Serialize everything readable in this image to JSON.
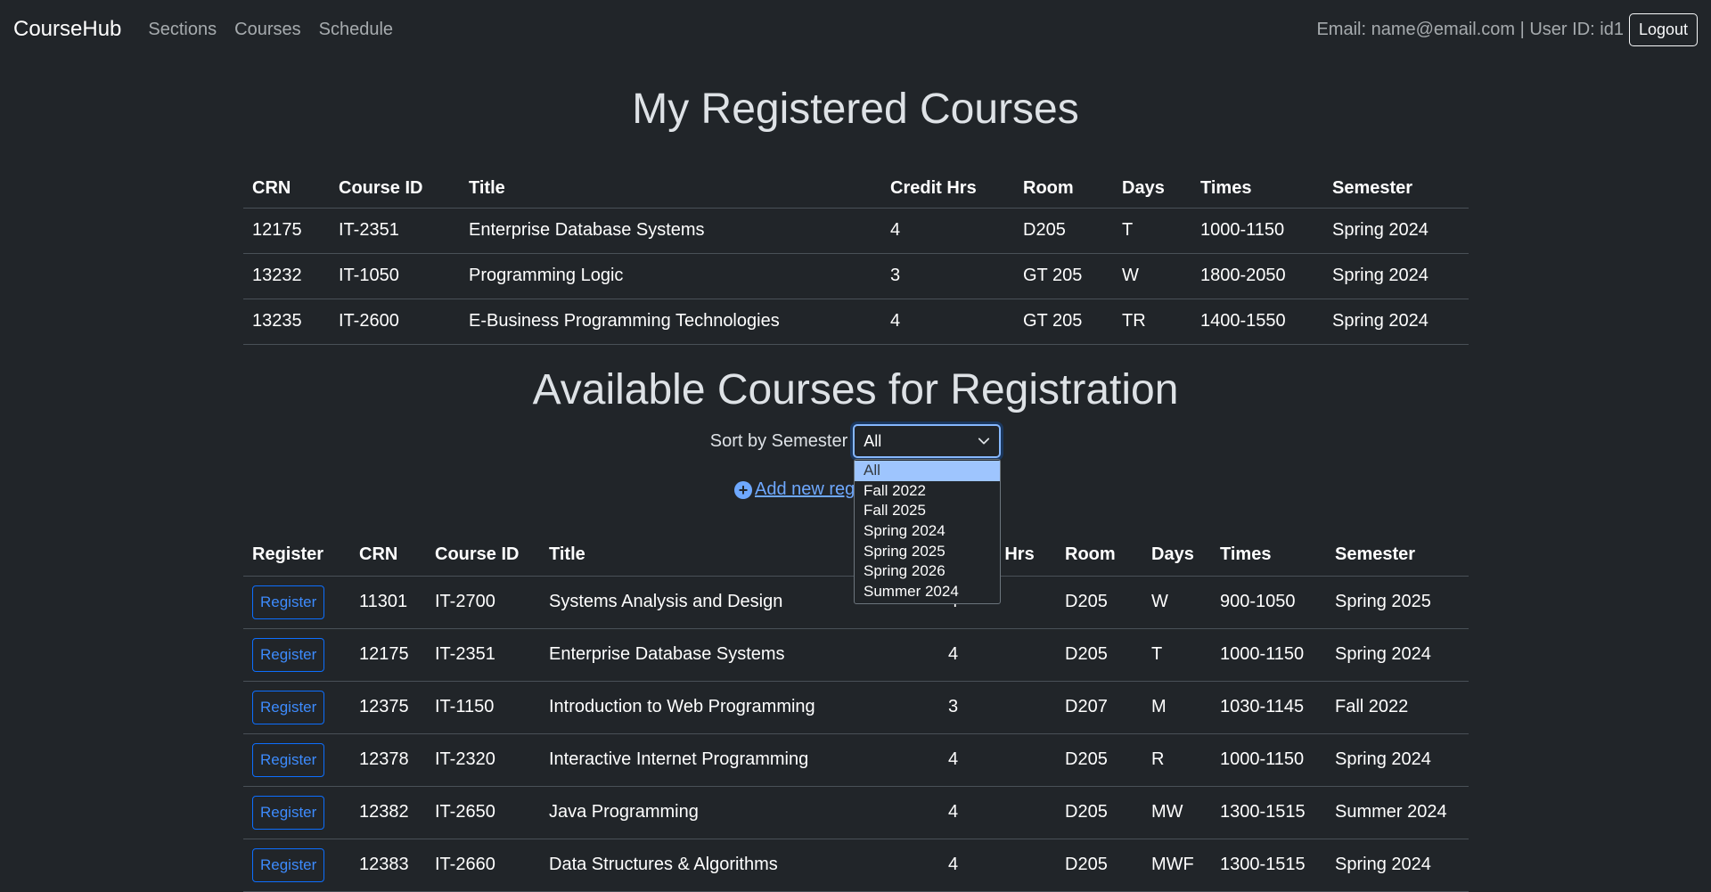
{
  "nav": {
    "brand": "CourseHub",
    "links": [
      "Sections",
      "Courses",
      "Schedule"
    ],
    "user_info": "Email: name@email.com | User ID: id1",
    "logout_label": "Logout"
  },
  "registered": {
    "title": "My Registered Courses",
    "headers": [
      "CRN",
      "Course ID",
      "Title",
      "Credit Hrs",
      "Room",
      "Days",
      "Times",
      "Semester"
    ],
    "rows": [
      [
        "12175",
        "IT-2351",
        "Enterprise Database Systems",
        "4",
        "D205",
        "T",
        "1000-1150",
        "Spring 2024"
      ],
      [
        "13232",
        "IT-1050",
        "Programming Logic",
        "3",
        "GT 205",
        "W",
        "1800-2050",
        "Spring 2024"
      ],
      [
        "13235",
        "IT-2600",
        "E-Business Programming Technologies",
        "4",
        "GT 205",
        "TR",
        "1400-1550",
        "Spring 2024"
      ]
    ]
  },
  "available": {
    "title": "Available Courses for Registration",
    "sort_label": "Sort by Semester",
    "sort_selected": "All",
    "sort_options": [
      "All",
      "Fall 2022",
      "Fall 2025",
      "Spring 2024",
      "Spring 2025",
      "Spring 2026",
      "Summer 2024"
    ],
    "add_link_label": "Add new reg",
    "register_label": "Register",
    "headers": [
      "Register",
      "CRN",
      "Course ID",
      "Title",
      "Credit Hrs",
      "Room",
      "Days",
      "Times",
      "Semester"
    ],
    "rows": [
      [
        "11301",
        "IT-2700",
        "Systems Analysis and Design",
        "4",
        "D205",
        "W",
        "900-1050",
        "Spring 2025"
      ],
      [
        "12175",
        "IT-2351",
        "Enterprise Database Systems",
        "4",
        "D205",
        "T",
        "1000-1150",
        "Spring 2024"
      ],
      [
        "12375",
        "IT-1150",
        "Introduction to Web Programming",
        "3",
        "D207",
        "M",
        "1030-1145",
        "Fall 2022"
      ],
      [
        "12378",
        "IT-2320",
        "Interactive Internet Programming",
        "4",
        "D205",
        "R",
        "1000-1150",
        "Spring 2024"
      ],
      [
        "12382",
        "IT-2650",
        "Java Programming",
        "4",
        "D205",
        "MW",
        "1300-1515",
        "Summer 2024"
      ],
      [
        "12383",
        "IT-2660",
        "Data Structures & Algorithms",
        "4",
        "D205",
        "MWF",
        "1300-1515",
        "Spring 2024"
      ]
    ]
  },
  "colors": {
    "background": "#212529",
    "accent": "#0d6efd",
    "selected_option": "#9ec5fe"
  },
  "icons": [
    "chevron-down-icon",
    "plus-circle-icon"
  ]
}
